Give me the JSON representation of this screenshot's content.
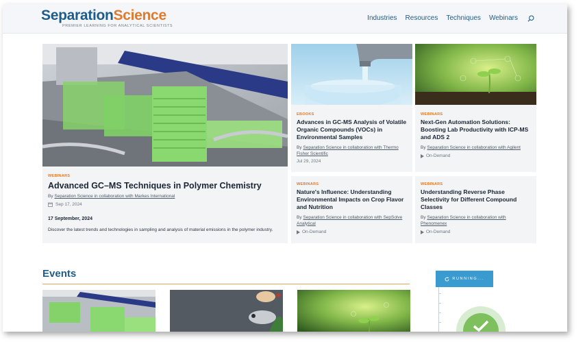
{
  "header": {
    "logo_part1": "Separation",
    "logo_part2": "Science",
    "tagline": "PREMIER LEARNING FOR ANALYTICAL SCIENTISTS",
    "nav": [
      "Industries",
      "Resources",
      "Techniques",
      "Webinars"
    ]
  },
  "featured": {
    "category": "WEBINARS",
    "title": "Advanced GC–MS Techniques in Polymer Chemistry",
    "by": "By",
    "byline": "Separation Science in collaboration with Markes International",
    "date": "Sep 17, 2024",
    "event_date": "17 September, 2024",
    "description": "Discover the latest trends and technologies in sampling and analysis of material emissions in the polymer industry."
  },
  "cards": [
    {
      "category": "EBOOKS",
      "title": "Advances in GC-MS Analysis of Volatile Organic Compounds (VOCs) in Environmental Samples",
      "by": "By",
      "byline": "Separation Science in collaboration with Thermo Fisher Scientific",
      "meta": "Jul 29, 2024"
    },
    {
      "category": "WEBINARS",
      "title": "Next-Gen Automation Solutions: Boosting Lab Productivity with ICP-MS and ADS 2",
      "by": "By",
      "byline": "Separation Science in collaboration with Agilent",
      "meta": "On-Demand"
    },
    {
      "category": "WEBINARS",
      "title": "Nature's Influence: Understanding Environmental Impacts on Crop Flavor and Nutrition",
      "by": "By",
      "byline": "Separation Science in collaboration with SepSolve Analytical",
      "meta": "On-Demand"
    },
    {
      "category": "WEBINARS",
      "title": "Understanding Reverse Phase Selectivity for Different Compound Classes",
      "by": "By",
      "byline": "Separation Science in collaboration with Phenomenex",
      "meta": "On-Demand"
    }
  ],
  "events": {
    "heading": "Events"
  },
  "running_panel": {
    "label": "RUNNING..."
  },
  "colors": {
    "brand_blue": "#1f5c8a",
    "brand_orange": "#e07a2c",
    "running_blue": "#3a9bd0"
  },
  "icons": [
    "search-icon",
    "calendar-icon",
    "play-icon",
    "refresh-icon",
    "check-icon"
  ]
}
